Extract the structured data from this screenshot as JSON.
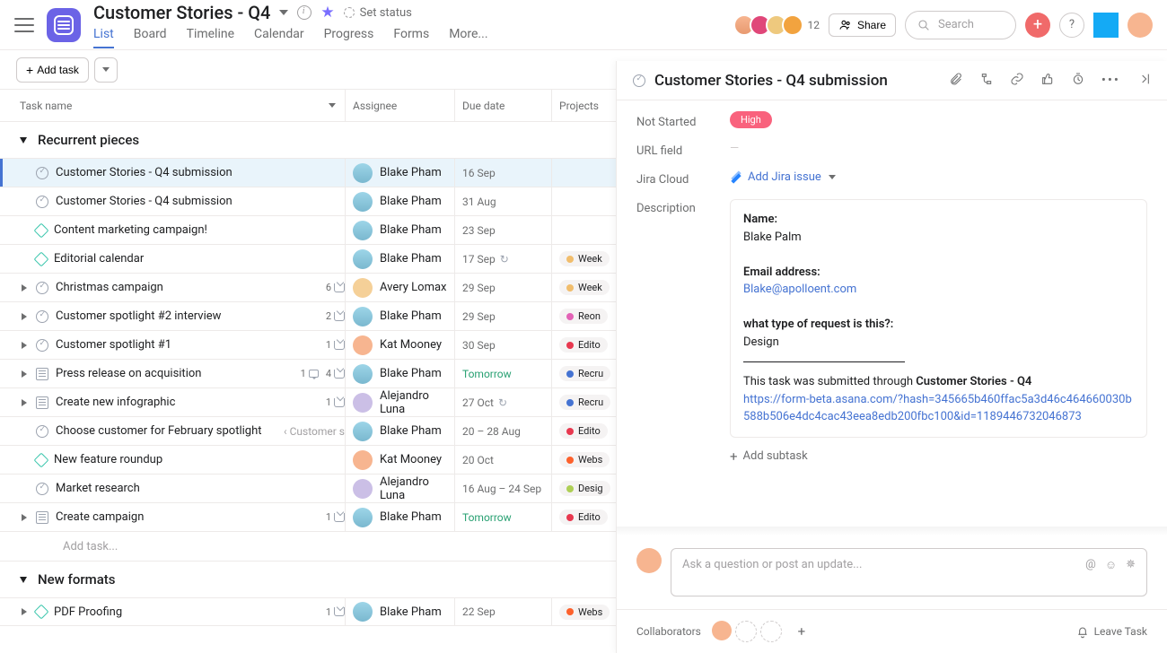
{
  "header": {
    "title": "Customer Stories - Q4",
    "set_status": "Set status",
    "tabs": [
      "List",
      "Board",
      "Timeline",
      "Calendar",
      "Progress",
      "Forms",
      "More..."
    ],
    "active_tab": "List",
    "member_count": "12",
    "share": "Share",
    "search_placeholder": "Search"
  },
  "toolbar": {
    "add_task": "Add task"
  },
  "columns": {
    "task": "Task name",
    "assignee": "Assignee",
    "due": "Due date",
    "projects": "Projects"
  },
  "sections": [
    {
      "name": "Recurrent pieces",
      "tasks": [
        {
          "icon": "check",
          "name": "Customer Stories - Q4 submission",
          "selected": true,
          "assignee": "Blake Pham",
          "av": "u-bp",
          "due": "16 Sep"
        },
        {
          "icon": "check",
          "name": "Customer Stories - Q4 submission",
          "assignee": "Blake Pham",
          "av": "u-bp",
          "due": "31 Aug"
        },
        {
          "icon": "diamond",
          "name": "Content  marketing campaign!",
          "assignee": "Blake Pham",
          "av": "u-bp",
          "due": "23 Sep"
        },
        {
          "icon": "diamond",
          "name": "Editorial calendar",
          "assignee": "Blake Pham",
          "av": "u-bp",
          "due": "17 Sep",
          "loop": true,
          "project": {
            "dot": "#f1bd6c",
            "label": "Week"
          }
        },
        {
          "icon": "check",
          "expand": true,
          "name": "Christmas campaign",
          "sub": "6",
          "assignee": "Avery Lomax",
          "av": "u-al",
          "due": "29 Sep",
          "project": {
            "dot": "#f1bd6c",
            "label": "Week"
          }
        },
        {
          "icon": "check",
          "expand": true,
          "name": "Customer spotlight #2 interview",
          "sub": "2",
          "assignee": "Blake Pham",
          "av": "u-bp",
          "due": "29 Sep",
          "project": {
            "dot": "#e362b6",
            "label": "Reon"
          }
        },
        {
          "icon": "check",
          "expand": true,
          "name": "Customer spotlight #1",
          "sub": "1",
          "assignee": "Kat Mooney",
          "av": "u-km",
          "due": "30 Sep",
          "project": {
            "dot": "#e8384f",
            "label": "Edito"
          }
        },
        {
          "icon": "form",
          "expand": true,
          "name": "Press release on acquisition",
          "com": "1",
          "sub": "4",
          "assignee": "Blake Pham",
          "av": "u-bp",
          "due": "Tomorrow",
          "due_green": true,
          "project": {
            "dot": "#4573d2",
            "label": "Recru"
          }
        },
        {
          "icon": "form",
          "expand": true,
          "name": "Create new infographic",
          "sub": "1",
          "assignee": "Alejandro Luna",
          "av": "u-alu",
          "due": "27 Oct",
          "loop": true,
          "project": {
            "dot": "#4573d2",
            "label": "Recru"
          }
        },
        {
          "icon": "check",
          "name": "Choose customer for February spotlight",
          "parent": "‹ Customer s",
          "assignee": "Blake Pham",
          "av": "u-bp",
          "due": "20 – 28 Aug",
          "project": {
            "dot": "#e8384f",
            "label": "Edito"
          }
        },
        {
          "icon": "diamond",
          "name": "New feature roundup",
          "assignee": "Kat Mooney",
          "av": "u-km",
          "due": "20 Oct",
          "project": {
            "dot": "#fd612c",
            "label": "Webs"
          }
        },
        {
          "icon": "check",
          "name": "Market research",
          "assignee": "Alejandro Luna",
          "av": "u-alu",
          "due": "16 Aug – 24 Sep",
          "project": {
            "dot": "#aecf55",
            "label": "Desig"
          }
        },
        {
          "icon": "form",
          "expand": true,
          "name": "Create campaign",
          "sub": "1",
          "assignee": "Blake Pham",
          "av": "u-bp",
          "due": "Tomorrow",
          "due_green": true,
          "project": {
            "dot": "#e8384f",
            "label": "Edito"
          }
        }
      ],
      "add_task_placeholder": "Add task..."
    },
    {
      "name": "New formats",
      "tasks": [
        {
          "icon": "diamond",
          "expand": true,
          "name": "PDF Proofing",
          "sub": "1",
          "assignee": "Blake Pham",
          "av": "u-bp",
          "due": "22 Sep",
          "project": {
            "dot": "#fd612c",
            "label": "Webs"
          }
        }
      ]
    }
  ],
  "detail": {
    "title": "Customer Stories - Q4 submission",
    "fields": {
      "not_started": {
        "label": "Not Started",
        "value": "High"
      },
      "url": {
        "label": "URL field",
        "value": "—"
      },
      "jira": {
        "label": "Jira Cloud",
        "value": "Add Jira issue"
      },
      "description_label": "Description"
    },
    "description": {
      "name_label": "Name:",
      "name": "Blake Palm",
      "email_label": "Email address:",
      "email": "Blake@apolloent.com",
      "req_label": "what type of request is this?:",
      "req": "Design",
      "footer_prefix": "This task was submitted through ",
      "footer_bold": "Customer Stories - Q4",
      "link": "https://form-beta.asana.com/?hash=345665b460ffac5a3d46c464660030b588b506e4dc4cac43eea8edb200fbc100&id=1189446732046873"
    },
    "add_subtask": "Add subtask",
    "comment_placeholder": "Ask a question or post an update...",
    "collaborators_label": "Collaborators",
    "leave_task": "Leave Task"
  }
}
